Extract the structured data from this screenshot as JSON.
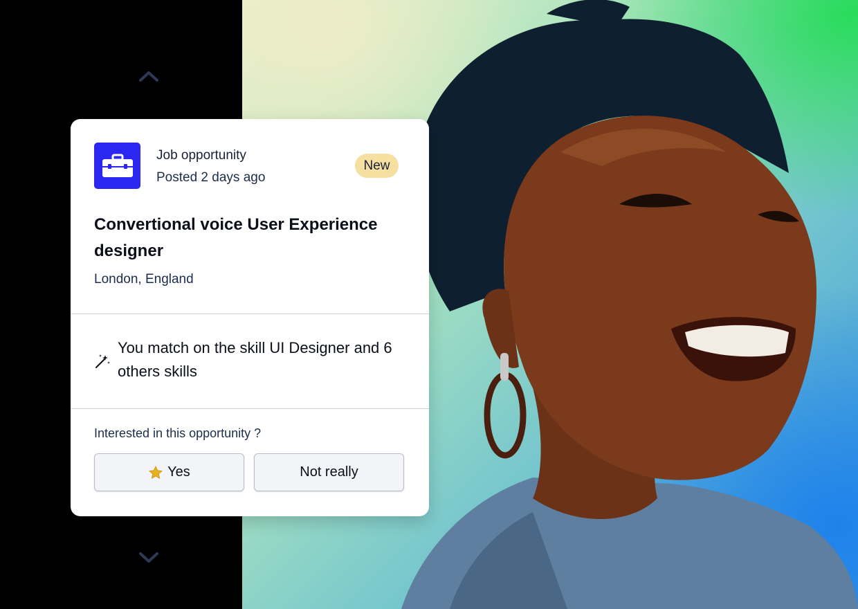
{
  "card": {
    "kind": "Job opportunity",
    "posted": "Posted 2 days ago",
    "badge": "New",
    "title": "Convertional voice User Experience designer",
    "location": "London, England",
    "match_text": "You match on the skill UI Designer and 6 others skills",
    "question": "Interested in this opportunity ?",
    "yes_label": "Yes",
    "no_label": "Not really"
  },
  "icons": {
    "job": "briefcase-icon",
    "match": "magic-wand-icon",
    "yes": "star-icon",
    "prev": "chevron-up-icon",
    "next": "chevron-down-icon"
  },
  "colors": {
    "brand_blue": "#2b26f0",
    "badge_bg": "#f5e0a1",
    "star": "#e6b21f"
  }
}
